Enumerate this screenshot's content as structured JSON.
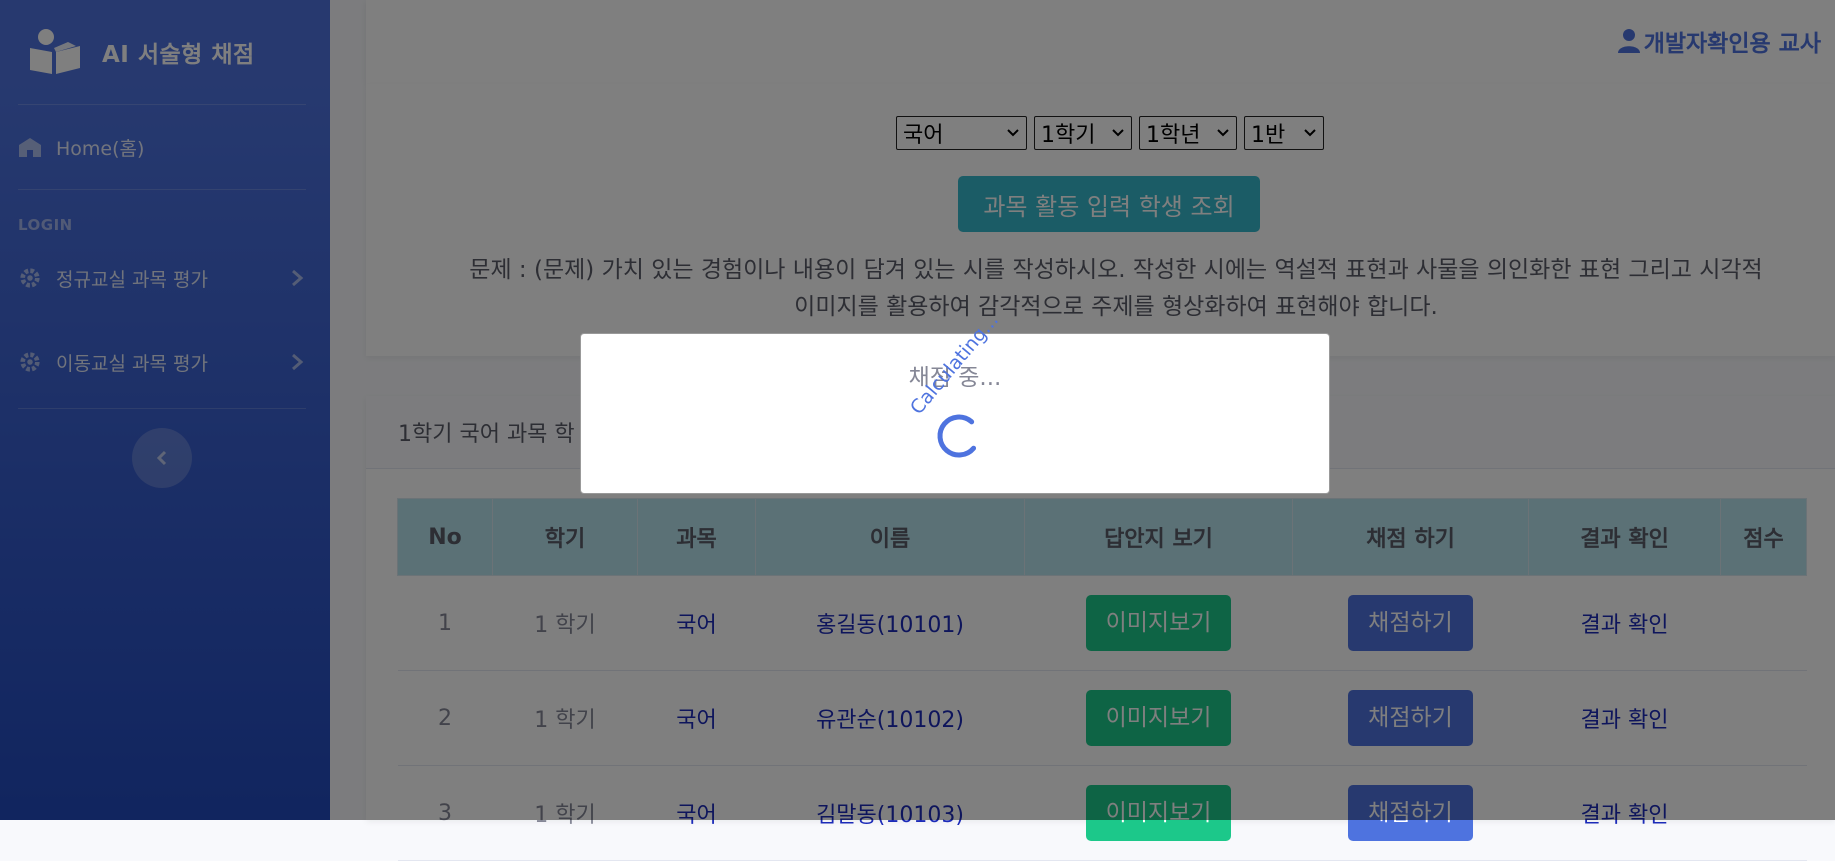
{
  "brand": {
    "title": "AI 서술형 채점"
  },
  "sidebar": {
    "items": [
      {
        "label": "Home(홈)",
        "icon": "school-icon"
      },
      {
        "label": "정규교실 과목 평가",
        "icon": "gear-icon"
      },
      {
        "label": "이동교실 과목 평가",
        "icon": "gear-icon"
      }
    ],
    "heading": "LOGIN"
  },
  "topbar": {
    "user": "개발자확인용 교사"
  },
  "filters": {
    "subject": "국어",
    "semester": "1학기",
    "grade": "1학년",
    "class": "1반",
    "search_button": "과목 활동 입력 학생 조회"
  },
  "question": {
    "line1": "문제 : (문제) 가치 있는 경험이나 내용이 담겨 있는 시를 작성하시오. 작성한 시에는 역설적 표현과 사물을 의인화한 표현 그리고 시각적",
    "line2": "이미지를 활용하여 감각적으로 주제를 형상화하여 표현해야 합니다."
  },
  "list": {
    "header": "1학기 국어 과목 학",
    "columns": [
      "No",
      "학기",
      "과목",
      "이름",
      "답안지 보기",
      "채점 하기",
      "결과 확인",
      "점수"
    ],
    "rows": [
      {
        "no": "1",
        "semester": "1 학기",
        "subject": "국어",
        "name": "홍길동(10101)",
        "view": "이미지보기",
        "grade": "채점하기",
        "result": "결과 확인",
        "score": ""
      },
      {
        "no": "2",
        "semester": "1 학기",
        "subject": "국어",
        "name": "유관순(10102)",
        "view": "이미지보기",
        "grade": "채점하기",
        "result": "결과 확인",
        "score": ""
      },
      {
        "no": "3",
        "semester": "1 학기",
        "subject": "국어",
        "name": "김말동(10103)",
        "view": "이미지보기",
        "grade": "채점하기",
        "result": "결과 확인",
        "score": ""
      }
    ]
  },
  "modal": {
    "title": "채점 중...",
    "spinner_text": "Calculating..."
  },
  "colors": {
    "primary": "#4e73df",
    "info": "#36b9cc",
    "success": "#1cc88a"
  }
}
